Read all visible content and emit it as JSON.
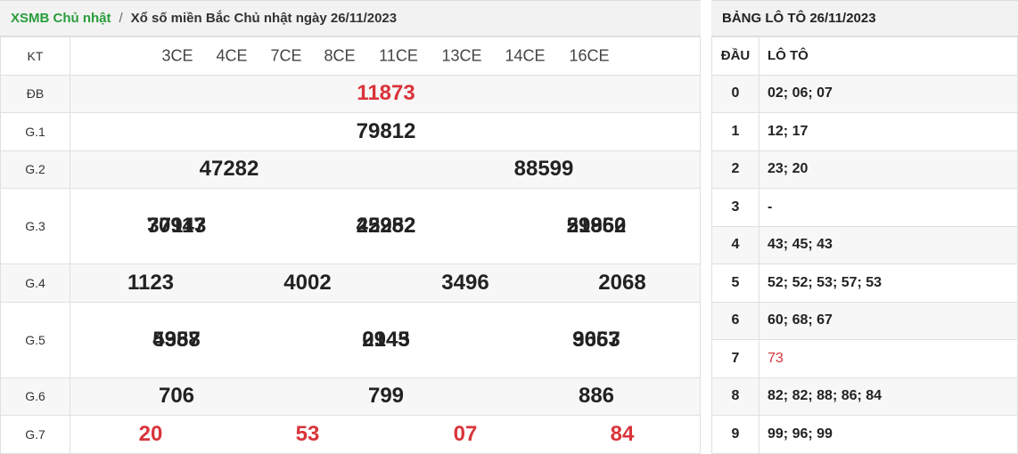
{
  "breadcrumb": {
    "link": "XSMB Chủ nhật",
    "separator": "/",
    "current": "Xổ số miền Bắc Chủ nhật ngày 26/11/2023"
  },
  "results": {
    "kt_label": "KT",
    "codes": [
      "3CE",
      "4CE",
      "7CE",
      "8CE",
      "11CE",
      "13CE",
      "14CE",
      "16CE"
    ],
    "prizes": [
      {
        "label": "ĐB",
        "numbers": [
          "11873"
        ],
        "red": true
      },
      {
        "label": "G.1",
        "numbers": [
          "79812"
        ]
      },
      {
        "label": "G.2",
        "numbers": [
          "47282",
          "88599"
        ]
      },
      {
        "label": "G.3",
        "numbers": [
          "70943",
          "22982",
          "59952",
          "37117",
          "45252",
          "21860"
        ]
      },
      {
        "label": "G.4",
        "numbers": [
          "1123",
          "4002",
          "3496",
          "2068"
        ]
      },
      {
        "label": "G.5",
        "numbers": [
          "4388",
          "0945",
          "3653",
          "5957",
          "2143",
          "9067"
        ]
      },
      {
        "label": "G.6",
        "numbers": [
          "706",
          "799",
          "886"
        ]
      },
      {
        "label": "G.7",
        "numbers": [
          "20",
          "53",
          "07",
          "84"
        ],
        "red": true
      }
    ]
  },
  "loto": {
    "title": "BẢNG LÔ TÔ 26/11/2023",
    "head_label": "ĐẦU",
    "loto_label": "LÔ TÔ",
    "rows": [
      {
        "head": "0",
        "values": "02; 06; 07"
      },
      {
        "head": "1",
        "values": "12; 17"
      },
      {
        "head": "2",
        "values": "23; 20"
      },
      {
        "head": "3",
        "values": "-"
      },
      {
        "head": "4",
        "values": "43; 45; 43"
      },
      {
        "head": "5",
        "values": "52; 52; 53; 57; 53"
      },
      {
        "head": "6",
        "values": "60; 68; 67"
      },
      {
        "head": "7",
        "values": "73",
        "red": true
      },
      {
        "head": "8",
        "values": "82; 82; 88; 86; 84"
      },
      {
        "head": "9",
        "values": "99; 96; 99"
      }
    ]
  },
  "colors": {
    "accent_green": "#2a9d3b",
    "highlight_red": "#d9343a"
  }
}
